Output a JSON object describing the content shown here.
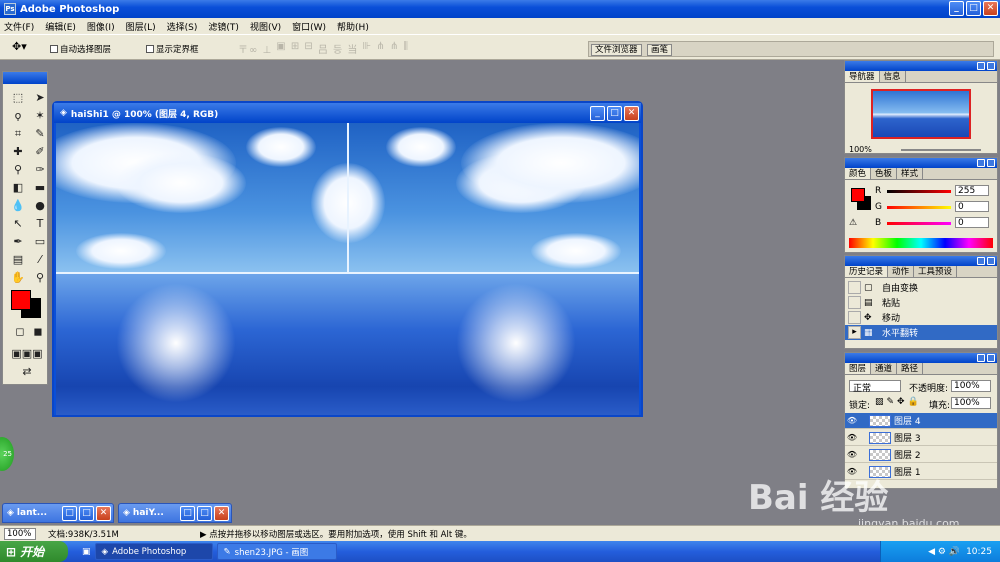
{
  "app": {
    "title": "Adobe Photoshop",
    "icon": "photoshop-icon"
  },
  "window_buttons": {
    "minimize": "_",
    "maximize": "□",
    "close": "✕"
  },
  "menu": [
    "文件(F)",
    "编辑(E)",
    "图像(I)",
    "图层(L)",
    "选择(S)",
    "滤镜(T)",
    "视图(V)",
    "窗口(W)",
    "帮助(H)"
  ],
  "options": {
    "auto_select": "自动选择图层",
    "show_bounds": "显示定界框",
    "tool_icon": "move-tool-icon",
    "align_glyphs": [
      "〒∞ ⊥",
      "▣ ⊞ ⊟",
      "吕 등 当",
      "⊪ ⋔ ⋔ ⫼"
    ]
  },
  "tab_well": [
    "文件浏览器",
    "画笔"
  ],
  "document": {
    "title": "haiShi1 @ 100% (图层 4, RGB)"
  },
  "colors": {
    "foreground": "#ff0000",
    "background": "#000000",
    "accent": "#0a4fd8"
  },
  "navigator": {
    "tabs": [
      "导航器",
      "信息"
    ],
    "zoom": "100%"
  },
  "color_panel": {
    "tabs": [
      "颜色",
      "色板",
      "样式"
    ],
    "channels": [
      {
        "label": "R",
        "value": "255"
      },
      {
        "label": "G",
        "value": "0"
      },
      {
        "label": "B",
        "value": "0"
      }
    ]
  },
  "history": {
    "tabs": [
      "历史记录",
      "动作",
      "工具预设"
    ],
    "items": [
      "自由变换",
      "粘贴",
      "移动",
      "水平翻转"
    ]
  },
  "layers": {
    "tabs": [
      "图层",
      "通道",
      "路径"
    ],
    "blend_mode": "正常",
    "opacity_label": "不透明度:",
    "opacity": "100%",
    "lock_label": "锁定:",
    "fill_label": "填充:",
    "fill": "100%",
    "items": [
      "图层 4",
      "图层 3",
      "图层 2",
      "图层 1"
    ]
  },
  "minimized": [
    {
      "title": "lant..."
    },
    {
      "title": "haiY..."
    }
  ],
  "status": {
    "zoom": "100%",
    "doc": "文档:938K/3.51M",
    "hint": "▶ 点按并拖移以移动图层或选区。要用附加选项，使用 Shift 和 Alt 键。"
  },
  "taskbar": {
    "start": "开始",
    "tasks": [
      "Adobe Photoshop",
      "shen23.JPG - 画图"
    ],
    "clock": "10:25"
  },
  "overlay": {
    "ball": "25",
    "watermark": "Bai 经验",
    "watermark_url": "jingyan.baidu.com"
  }
}
